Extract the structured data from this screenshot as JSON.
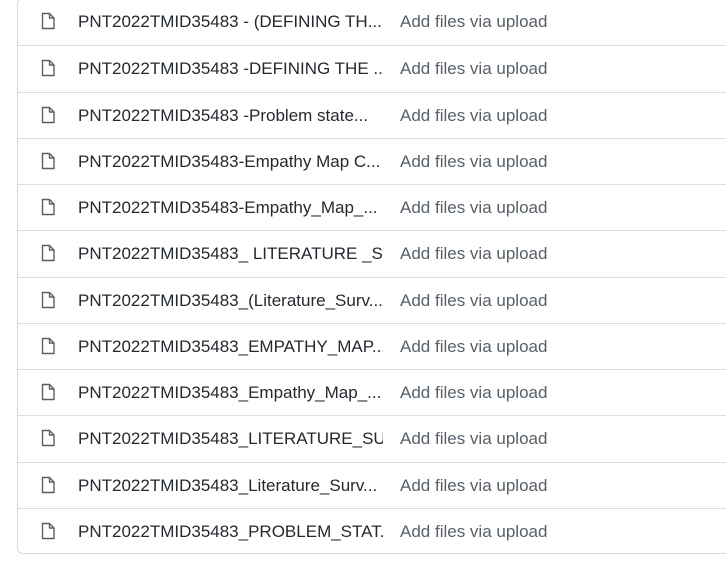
{
  "files": [
    {
      "name": "PNT2022TMID35483 - (DEFINING TH...",
      "commit": "Add files via upload",
      "icon": "file-icon"
    },
    {
      "name": "PNT2022TMID35483 -DEFINING THE ...",
      "commit": "Add files via upload",
      "icon": "file-icon"
    },
    {
      "name": "PNT2022TMID35483 -Problem state...",
      "commit": "Add files via upload",
      "icon": "file-icon"
    },
    {
      "name": "PNT2022TMID35483-Empathy Map C...",
      "commit": "Add files via upload",
      "icon": "file-icon"
    },
    {
      "name": "PNT2022TMID35483-Empathy_Map_...",
      "commit": "Add files via upload",
      "icon": "file-icon"
    },
    {
      "name": "PNT2022TMID35483_ LITERATURE _S...",
      "commit": "Add files via upload",
      "icon": "file-icon"
    },
    {
      "name": "PNT2022TMID35483_(Literature_Surv...",
      "commit": "Add files via upload",
      "icon": "file-icon"
    },
    {
      "name": "PNT2022TMID35483_EMPATHY_MAP...",
      "commit": "Add files via upload",
      "icon": "file-icon"
    },
    {
      "name": "PNT2022TMID35483_Empathy_Map_...",
      "commit": "Add files via upload",
      "icon": "file-icon"
    },
    {
      "name": "PNT2022TMID35483_LITERATURE_SU...",
      "commit": "Add files via upload",
      "icon": "file-icon"
    },
    {
      "name": "PNT2022TMID35483_Literature_Surv...",
      "commit": "Add files via upload",
      "icon": "file-icon"
    },
    {
      "name": "PNT2022TMID35483_PROBLEM_STAT...",
      "commit": "Add files via upload",
      "icon": "file-icon"
    }
  ],
  "colors": {
    "file_name": "#24292f",
    "commit_message": "#57606a",
    "icon": "#57606a",
    "border": "#d0d7de"
  }
}
